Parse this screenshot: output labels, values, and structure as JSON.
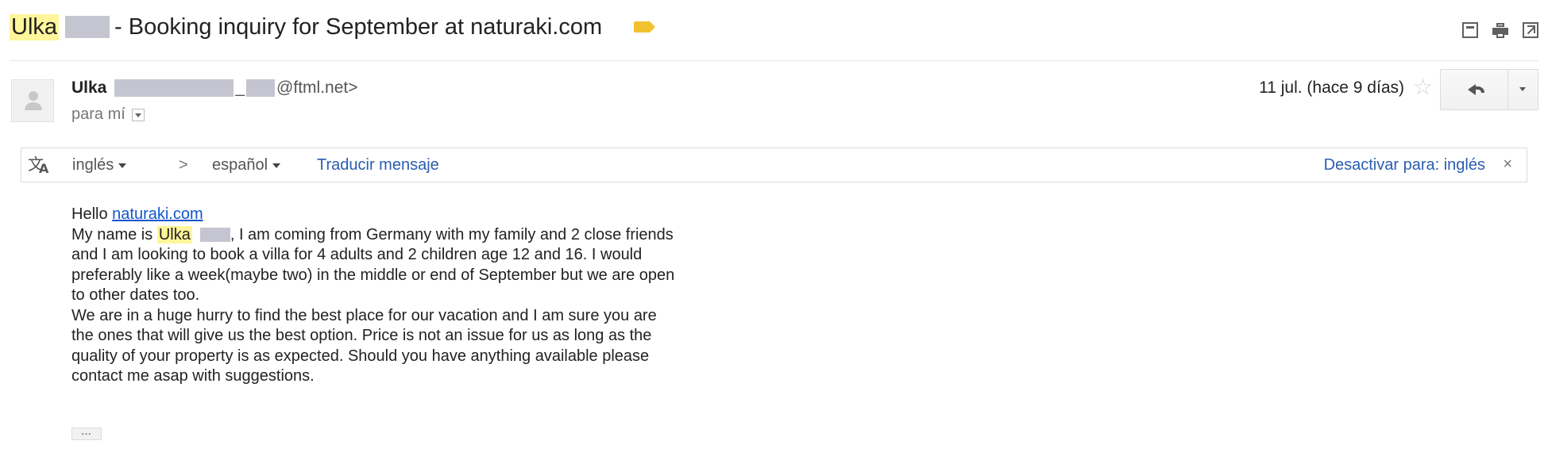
{
  "subject": {
    "sender_first": "Ulka",
    "title": "- Booking inquiry for September at naturaki.com"
  },
  "toolbar_icons": [
    "archive-icon",
    "print-icon",
    "new-window-icon"
  ],
  "sender": {
    "name": "Ulka",
    "underscore": "_",
    "email_suffix": "@ftml.net>",
    "recipient": "para mí"
  },
  "date": "11 jul. (hace 9 días)",
  "translate_bar": {
    "from_lang": "inglés",
    "arrow": ">",
    "to_lang": "español",
    "translate_label": "Traducir mensaje",
    "disable_label": "Desactivar para: inglés",
    "close": "×"
  },
  "body": {
    "greeting": "Hello",
    "greeting_link": "naturaki.com",
    "line_prefix": "My name is",
    "highlighted_name": "Ulka",
    "paragraph_1_rest": ", I am coming from Germany with my family and 2 close friends and I am looking to book a villa for 4 adults and 2 children age 12 and 16. I would preferably like a week(maybe two) in the middle or end of September but we are open to other dates too.",
    "paragraph_2": "We are in a huge hurry to find the best place for our vacation and I am sure you are the ones that will give us the best option. Price is not an issue for us as long as the quality of your property is as expected. Should you have anything available please contact me asap with suggestions.",
    "trimmed_content": "..."
  },
  "colors": {
    "highlight": "#fff59a",
    "redaction": "#c5c5d2",
    "link": "#1155cc",
    "label_tag": "#f2c12e"
  }
}
